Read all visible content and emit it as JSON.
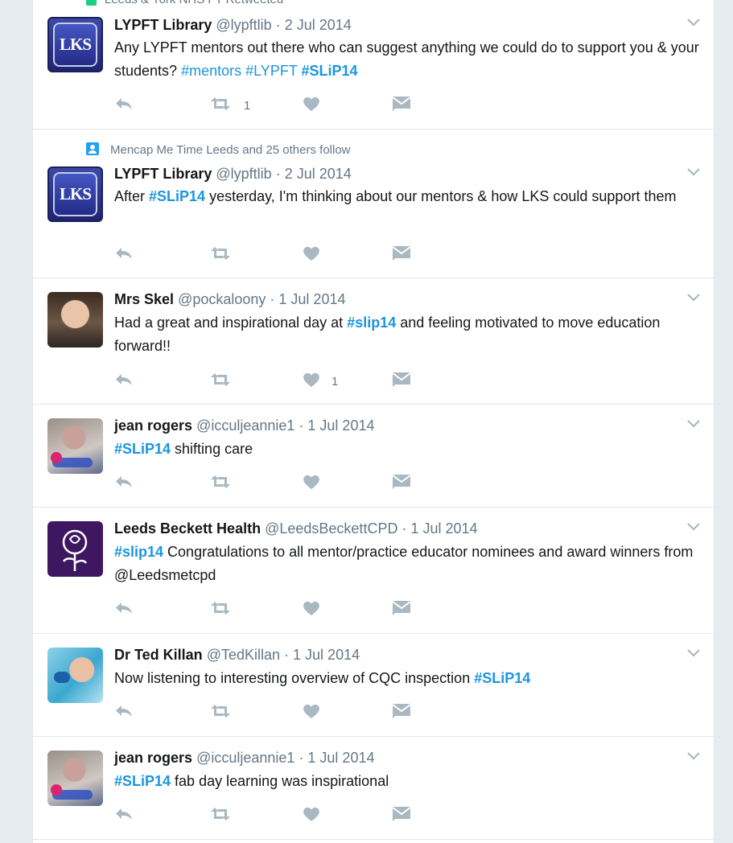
{
  "partial_top": "Leeds & York NHS FT Retweeted",
  "tweets": [
    {
      "avatar": "LKS",
      "name": "LYPFT Library",
      "handle": "@lypftlib",
      "sep": " · ",
      "date": "2 Jul 2014",
      "text": [
        {
          "t": "Any LYPFT mentors out there who can suggest anything we could do to support you & your students? "
        },
        {
          "h": "#mentors"
        },
        {
          "t": " "
        },
        {
          "h": "#LYPFT"
        },
        {
          "t": " "
        },
        {
          "hb": "#SLiP14"
        }
      ],
      "retweet_count": "1",
      "like_count": ""
    },
    {
      "avatar": "LKS",
      "social": "Mencap Me Time Leeds and 25 others follow",
      "name": "LYPFT Library",
      "handle": "@lypftlib",
      "sep": " · ",
      "date": "2 Jul 2014",
      "text": [
        {
          "t": "After "
        },
        {
          "hb": "#SLiP14"
        },
        {
          "t": " yesterday, I'm thinking about our mentors & how LKS could support them"
        }
      ],
      "retweet_count": "",
      "like_count": ""
    },
    {
      "name": "Mrs Skel",
      "handle": "@pockaloony",
      "sep": " · ",
      "date": "1 Jul 2014",
      "text": [
        {
          "t": "Had a great and inspirational day at "
        },
        {
          "hb": "#slip14"
        },
        {
          "t": " and feeling motivated to move education forward!!"
        }
      ],
      "retweet_count": "",
      "like_count": "1"
    },
    {
      "name": "jean rogers",
      "handle": "@icculjeannie1",
      "sep": " · ",
      "date": "1 Jul 2014",
      "text": [
        {
          "hb": "#SLiP14"
        },
        {
          "t": " shifting care"
        }
      ],
      "retweet_count": "",
      "like_count": ""
    },
    {
      "name": "Leeds Beckett Health",
      "handle": "@LeedsBeckettCPD",
      "sep": " · ",
      "date": "1 Jul 2014",
      "text": [
        {
          "hb": "#slip14"
        },
        {
          "t": " Congratulations to all mentor/practice educator nominees and award winners from @Leedsmetcpd"
        }
      ],
      "retweet_count": "",
      "like_count": ""
    },
    {
      "name": "Dr Ted Killan",
      "handle": "@TedKillan",
      "sep": " · ",
      "date": "1 Jul 2014",
      "text": [
        {
          "t": "Now listening to interesting overview of CQC inspection "
        },
        {
          "hb": "#SLiP14"
        }
      ],
      "retweet_count": "",
      "like_count": ""
    },
    {
      "name": "jean rogers",
      "handle": "@icculjeannie1",
      "sep": " · ",
      "date": "1 Jul 2014",
      "text": [
        {
          "hb": "#SLiP14"
        },
        {
          "t": " fab day learning was inspirational"
        }
      ],
      "retweet_count": "",
      "like_count": ""
    }
  ]
}
